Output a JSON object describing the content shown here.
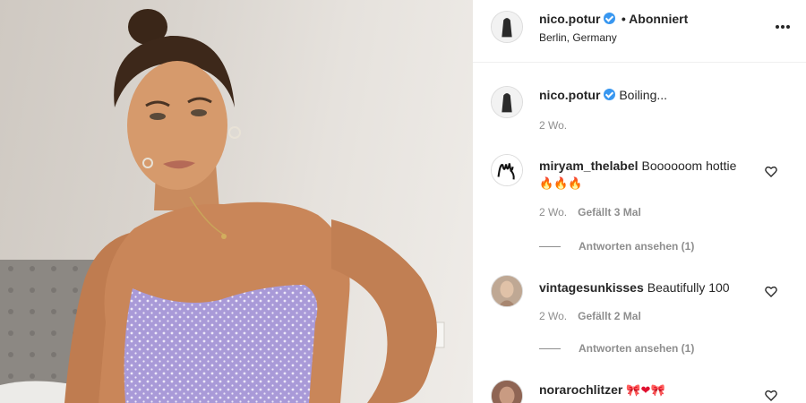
{
  "post": {
    "author": "nico.potur",
    "follow_status": "• Abonniert",
    "location": "Berlin, Germany"
  },
  "caption": {
    "username": "nico.potur",
    "text": "Boiling...",
    "time": "2 Wo."
  },
  "comments": [
    {
      "username": "miryam_thelabel",
      "text": "Boooooom hottie",
      "emoji": "🔥🔥🔥",
      "time": "2 Wo.",
      "likes": "Gefällt 3 Mal",
      "replies": "Antworten ansehen (1)"
    },
    {
      "username": "vintagesunkisses",
      "text": "Beautifully 100",
      "emoji": "",
      "time": "2 Wo.",
      "likes": "Gefällt 2 Mal",
      "replies": "Antworten ansehen (1)"
    },
    {
      "username": "norarochlitzer",
      "text": "",
      "emoji": "🎀❤🎀",
      "time": "",
      "likes": "",
      "replies": ""
    }
  ],
  "icons": {
    "verified": "verified-badge-icon",
    "more": "more-options-icon",
    "like": "heart-outline-icon"
  },
  "colors": {
    "verified": "#3897f0",
    "secondary_text": "#8e8e8e",
    "primary_text": "#262626"
  }
}
